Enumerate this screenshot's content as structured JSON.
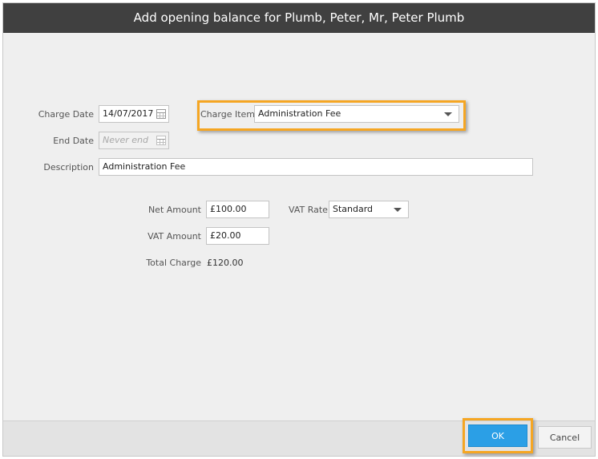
{
  "dialog": {
    "title": "Add opening balance for Plumb, Peter, Mr, Peter Plumb"
  },
  "form": {
    "charge_date_label": "Charge Date",
    "charge_date_value": "14/07/2017",
    "end_date_label": "End Date",
    "end_date_placeholder": "Never end",
    "charge_item_label": "Charge Item",
    "charge_item_value": "Administration Fee",
    "description_label": "Description",
    "description_value": "Administration Fee",
    "net_amount_label": "Net Amount",
    "net_amount_value": "£100.00",
    "vat_rate_label": "VAT Rate",
    "vat_rate_value": "Standard",
    "vat_amount_label": "VAT Amount",
    "vat_amount_value": "£20.00",
    "total_charge_label": "Total Charge",
    "total_charge_value": "£120.00"
  },
  "footer": {
    "ok_label": "OK",
    "cancel_label": "Cancel"
  },
  "colors": {
    "titlebar": "#404040",
    "highlight": "#f5a623",
    "ok_button": "#2b9fe6"
  },
  "icons": {
    "calendar": "calendar-icon",
    "dropdown": "chevron-down-icon"
  }
}
